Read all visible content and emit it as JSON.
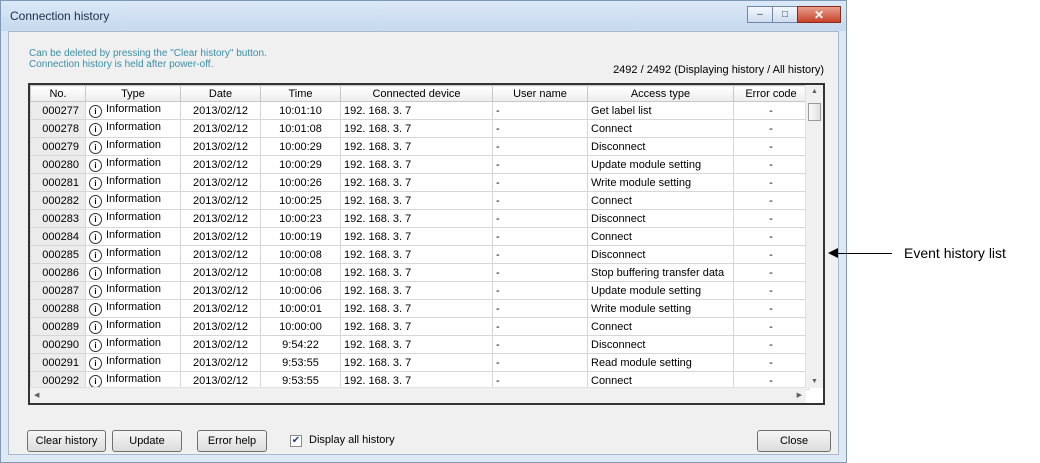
{
  "window": {
    "title": "Connection history",
    "minimize_glyph": "–",
    "maximize_glyph": "□",
    "close_glyph": "✕"
  },
  "notes": {
    "line1": "Can be deleted by pressing the \"Clear history\" button.",
    "line2": "Connection history is held after power-off."
  },
  "count_text": "2492 / 2492 (Displaying history / All history)",
  "table": {
    "headers": [
      "No.",
      "Type",
      "Date",
      "Time",
      "Connected device",
      "User name",
      "Access type",
      "Error code"
    ],
    "type_icon": "info-icon",
    "rows": [
      [
        "000277",
        "Information",
        "2013/02/12",
        "10:01:10",
        "192. 168. 3. 7",
        "-",
        "Get label list",
        "-"
      ],
      [
        "000278",
        "Information",
        "2013/02/12",
        "10:01:08",
        "192. 168. 3. 7",
        "-",
        "Connect",
        "-"
      ],
      [
        "000279",
        "Information",
        "2013/02/12",
        "10:00:29",
        "192. 168. 3. 7",
        "-",
        "Disconnect",
        "-"
      ],
      [
        "000280",
        "Information",
        "2013/02/12",
        "10:00:29",
        "192. 168. 3. 7",
        "-",
        "Update module setting",
        "-"
      ],
      [
        "000281",
        "Information",
        "2013/02/12",
        "10:00:26",
        "192. 168. 3. 7",
        "-",
        "Write module setting",
        "-"
      ],
      [
        "000282",
        "Information",
        "2013/02/12",
        "10:00:25",
        "192. 168. 3. 7",
        "-",
        "Connect",
        "-"
      ],
      [
        "000283",
        "Information",
        "2013/02/12",
        "10:00:23",
        "192. 168. 3. 7",
        "-",
        "Disconnect",
        "-"
      ],
      [
        "000284",
        "Information",
        "2013/02/12",
        "10:00:19",
        "192. 168. 3. 7",
        "-",
        "Connect",
        "-"
      ],
      [
        "000285",
        "Information",
        "2013/02/12",
        "10:00:08",
        "192. 168. 3. 7",
        "-",
        "Disconnect",
        "-"
      ],
      [
        "000286",
        "Information",
        "2013/02/12",
        "10:00:08",
        "192. 168. 3. 7",
        "-",
        "Stop buffering transfer data",
        "-"
      ],
      [
        "000287",
        "Information",
        "2013/02/12",
        "10:00:06",
        "192. 168. 3. 7",
        "-",
        "Update module setting",
        "-"
      ],
      [
        "000288",
        "Information",
        "2013/02/12",
        "10:00:01",
        "192. 168. 3. 7",
        "-",
        "Write module setting",
        "-"
      ],
      [
        "000289",
        "Information",
        "2013/02/12",
        "10:00:00",
        "192. 168. 3. 7",
        "-",
        "Connect",
        "-"
      ],
      [
        "000290",
        "Information",
        "2013/02/12",
        "9:54:22",
        "192. 168. 3. 7",
        "-",
        "Disconnect",
        "-"
      ],
      [
        "000291",
        "Information",
        "2013/02/12",
        "9:53:55",
        "192. 168. 3. 7",
        "-",
        "Read module setting",
        "-"
      ],
      [
        "000292",
        "Information",
        "2013/02/12",
        "9:53:55",
        "192. 168. 3. 7",
        "-",
        "Connect",
        "-"
      ]
    ]
  },
  "buttons": {
    "clear_history": "Clear history",
    "update": "Update",
    "error_help": "Error help",
    "close": "Close"
  },
  "display_all": {
    "label": "Display all history",
    "checked": true,
    "check_glyph": "✔"
  },
  "annotation": {
    "label": "Event history list"
  }
}
